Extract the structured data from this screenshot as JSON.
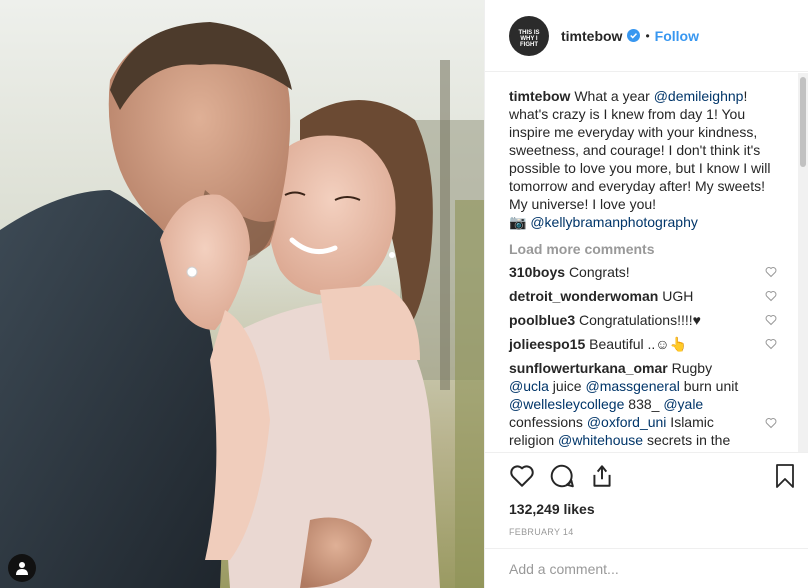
{
  "post": {
    "username": "timtebow",
    "dot": "•",
    "follow_label": "Follow",
    "avatar_text": "THIS IS WHY I FIGHT",
    "caption": {
      "username": "timtebow",
      "text_1": "What a year ",
      "mention_1": "@demileighnp",
      "text_2": "! what's crazy is I knew from day 1! You inspire me everyday with your kindness, sweetness, and courage! I don't think it's possible to love you more, but I know I will tomorrow and everyday after! My sweets! My universe! I love you!",
      "camera_glyph": "📷",
      "credit": "@kellybramanphotography"
    },
    "load_more_label": "Load more comments",
    "comments": [
      {
        "user": "310boys",
        "text": "Congrats!"
      },
      {
        "user": "detroit_wonderwoman",
        "text": "UGH"
      },
      {
        "user": "poolblue3",
        "text": "Congratulations!!!!♥"
      },
      {
        "user": "jolieespo15",
        "text": "Beautiful ..☺👆"
      }
    ],
    "long_comment": {
      "user": "sunflowerturkana_omar",
      "t1": "Rugby ",
      "m1": "@ucla",
      "t2": " juice ",
      "m2": "@massgeneral",
      "t3": " burn unit ",
      "m3": "@wellesleycollege",
      "t4": " 838_ ",
      "m4": "@yale",
      "t5": " confessions ",
      "m5": "@oxford_uni",
      "t6": " Islamic religion ",
      "m6": "@whitehouse",
      "t7": " secrets in the"
    },
    "likes": "132,249 likes",
    "date": "FEBRUARY 14",
    "comment_placeholder": "Add a comment..."
  },
  "colors": {
    "accent": "#3897f0",
    "mention": "#003569",
    "muted": "#999999"
  },
  "icons": [
    "verified-badge-icon",
    "heart-icon",
    "comment-icon",
    "share-icon",
    "bookmark-icon",
    "user-tag-icon"
  ]
}
